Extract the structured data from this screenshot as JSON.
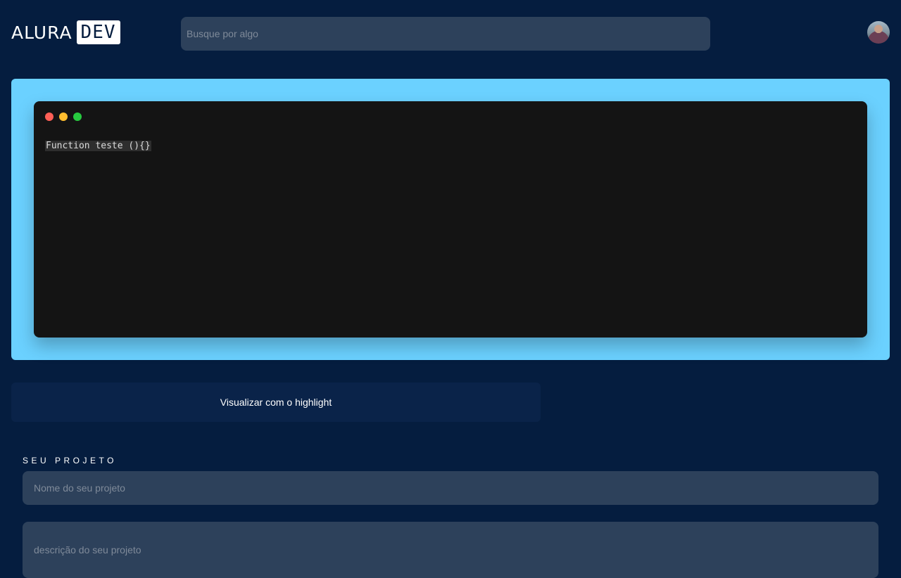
{
  "header": {
    "logo_text": "ALURA",
    "logo_box": "DEV",
    "search_placeholder": "Busque por algo"
  },
  "editor": {
    "dots": [
      "red",
      "yellow",
      "green"
    ],
    "code": "Function teste (){}",
    "accent_color": "#6bd1ff"
  },
  "actions": {
    "highlight_label": "Visualizar com o highlight"
  },
  "project": {
    "section_title": "SEU PROJETO",
    "name_placeholder": "Nome do seu projeto",
    "description_placeholder": "descrição do seu projeto"
  }
}
